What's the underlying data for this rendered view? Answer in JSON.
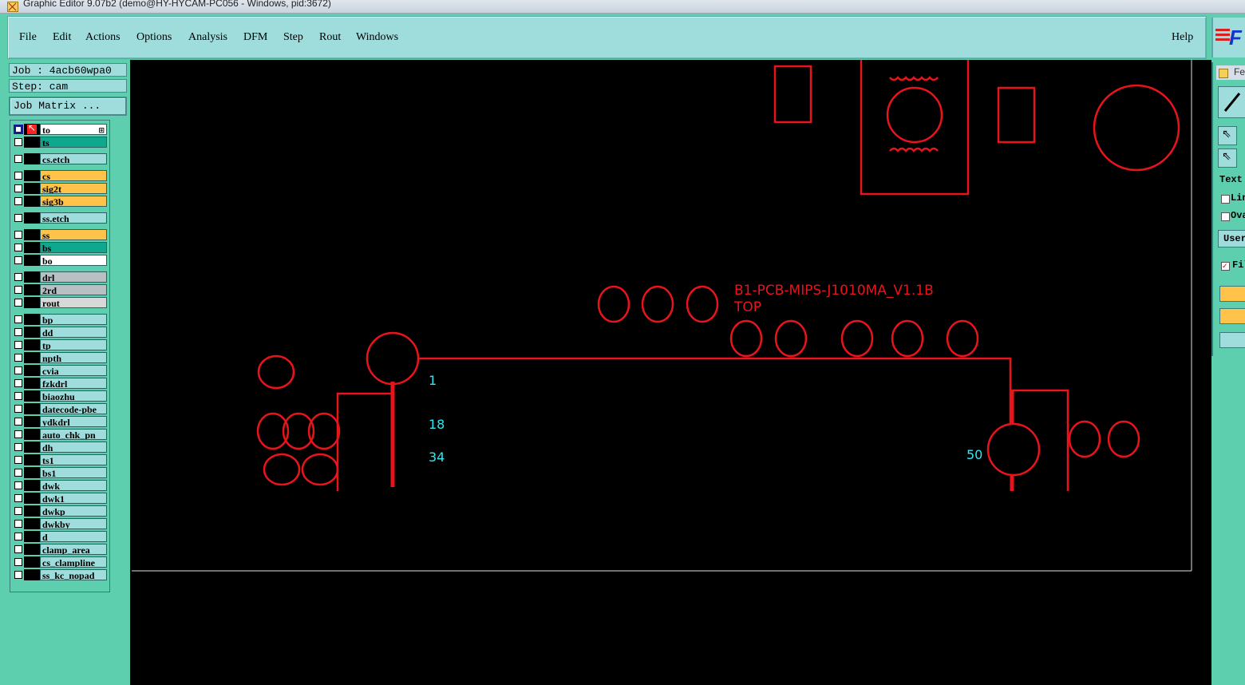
{
  "window": {
    "title": "Graphic Editor 9.07b2 (demo@HY-HYCAM-PC056 - Windows, pid:3672)"
  },
  "menu": {
    "items": [
      "File",
      "Edit",
      "Actions",
      "Options",
      "Analysis",
      "DFM",
      "Step",
      "Rout",
      "Windows"
    ],
    "help": "Help"
  },
  "logo": "F",
  "job": {
    "job_label": "Job : 4acb60wpa0",
    "step_label": "Step: cam",
    "matrix_button": "Job Matrix ..."
  },
  "layers": [
    {
      "name": "to",
      "color": "#ffffff"
    },
    {
      "name": "ts",
      "color": "#0fa88e"
    },
    {
      "name": "cs.etch",
      "color": "#9fdcdc"
    },
    {
      "name": "cs",
      "color": "#ffc24a"
    },
    {
      "name": "sig2t",
      "color": "#ffc24a"
    },
    {
      "name": "sig3b",
      "color": "#ffc24a"
    },
    {
      "name": "ss.etch",
      "color": "#9fdcdc"
    },
    {
      "name": "ss",
      "color": "#ffc24a"
    },
    {
      "name": "bs",
      "color": "#0fa88e"
    },
    {
      "name": "bo",
      "color": "#ffffff"
    },
    {
      "name": "drl",
      "color": "#b8c0c4"
    },
    {
      "name": "2rd",
      "color": "#b8c0c4"
    },
    {
      "name": "rout",
      "color": "#d8d8d8"
    },
    {
      "name": "bp",
      "color": "#9fdcdc"
    },
    {
      "name": "dd",
      "color": "#9fdcdc"
    },
    {
      "name": "tp",
      "color": "#9fdcdc"
    },
    {
      "name": "npth",
      "color": "#9fdcdc"
    },
    {
      "name": "cvia",
      "color": "#9fdcdc"
    },
    {
      "name": "fzkdrl",
      "color": "#9fdcdc"
    },
    {
      "name": "biaozhu",
      "color": "#9fdcdc"
    },
    {
      "name": "datecode-pbe",
      "color": "#9fdcdc"
    },
    {
      "name": "ydkdrl",
      "color": "#9fdcdc"
    },
    {
      "name": "auto_chk_pn",
      "color": "#9fdcdc"
    },
    {
      "name": "dh",
      "color": "#9fdcdc"
    },
    {
      "name": "ts1",
      "color": "#9fdcdc"
    },
    {
      "name": "bs1",
      "color": "#9fdcdc"
    },
    {
      "name": "dwk",
      "color": "#9fdcdc"
    },
    {
      "name": "dwk1",
      "color": "#9fdcdc"
    },
    {
      "name": "dwkp",
      "color": "#9fdcdc"
    },
    {
      "name": "dwkby",
      "color": "#9fdcdc"
    },
    {
      "name": "d",
      "color": "#9fdcdc"
    },
    {
      "name": "clamp_area",
      "color": "#9fdcdc"
    },
    {
      "name": "cs_clampline",
      "color": "#9fdcdc"
    },
    {
      "name": "ss_kc_nopad",
      "color": "#9fdcdc"
    }
  ],
  "canvas": {
    "board_label": "B1-PCB-MIPS-J1010MA_V1.1B",
    "side_label": "TOP",
    "pin_labels": [
      "1",
      "18",
      "34",
      "50"
    ],
    "feature_color": "#e8141c",
    "pin_label_color": "#2ee8f0"
  },
  "right_panel": {
    "title": "Fea",
    "text_label": "Text",
    "line_label": "Lin",
    "oval_label": "Ova",
    "user_label": "User",
    "filter_label": "Fil"
  }
}
